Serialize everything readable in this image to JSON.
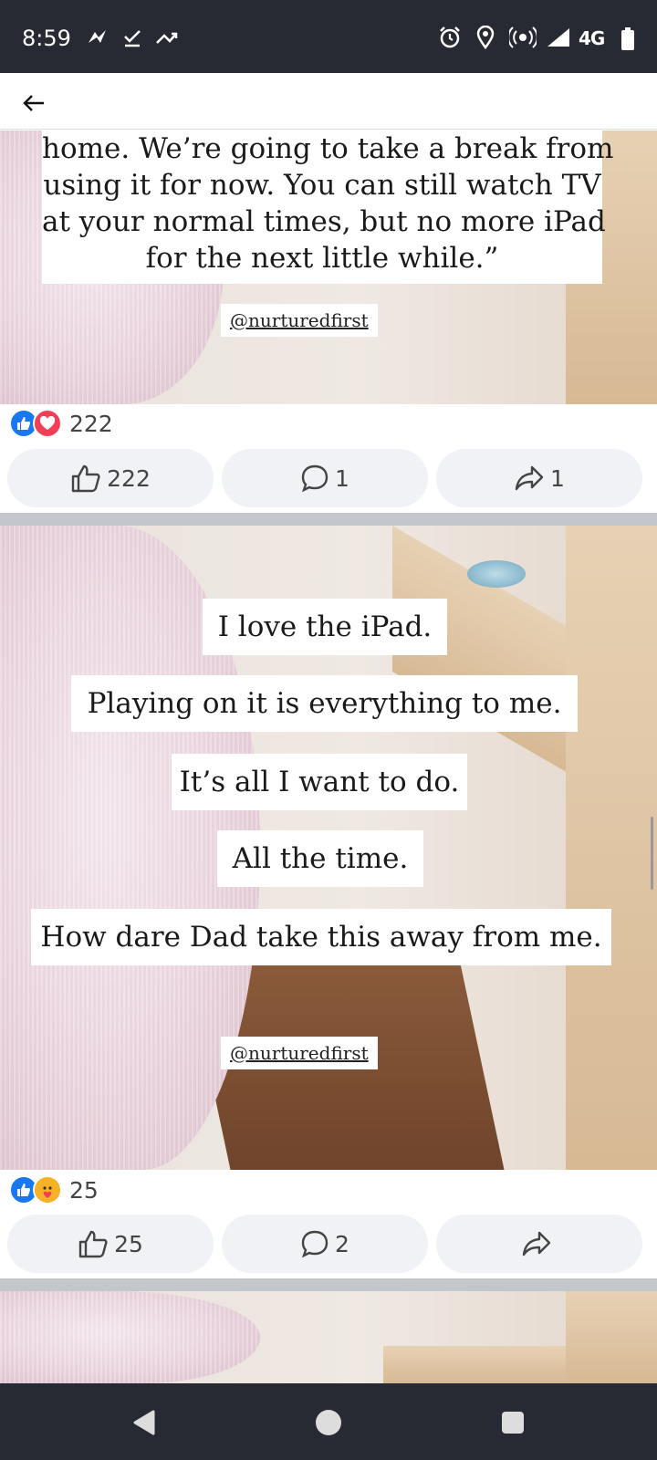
{
  "status_bar": {
    "time": "8:59",
    "network": "4G",
    "icons": [
      "messenger-icon",
      "check-icon",
      "missed-call-icon",
      "alarm-icon",
      "location-icon",
      "hotspot-icon",
      "signal-icon",
      "battery-icon"
    ]
  },
  "post1": {
    "caption_lines": [
      "home. We’re going to take a break from",
      "using it for now. You can still watch TV",
      "at your normal times, but no more iPad",
      "for the next little while.”"
    ],
    "credit": "@nurturedfirst",
    "reaction_count": "222",
    "like_count": "222",
    "comment_count": "1",
    "share_count": "1"
  },
  "post2": {
    "caption_lines": [
      "I love the iPad.",
      "Playing on it is everything to me.",
      "It’s all I want to do.",
      "All the time.",
      "How dare Dad take this away from me."
    ],
    "credit": "@nurturedfirst",
    "reaction_count": "25",
    "like_count": "25",
    "comment_count": "2"
  },
  "colors": {
    "status_bar": "#272a33",
    "like_blue": "#1877f2",
    "love_red": "#f33e58",
    "care_yellow": "#f7b125",
    "button_bg": "#f0f2f5",
    "divider": "#c3c7cc"
  }
}
